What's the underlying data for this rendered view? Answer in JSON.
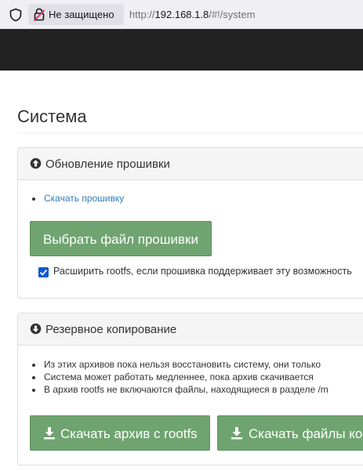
{
  "browser": {
    "security_label": "Не защищено",
    "url_scheme": "http://",
    "url_host": "192.168.1.8",
    "url_path": "/#!/system"
  },
  "page": {
    "title": "Система"
  },
  "firmware_panel": {
    "title": "Обновление прошивки",
    "links": [
      "Скачать прошивку"
    ],
    "choose_button": "Выбрать файл прошивки",
    "expand_rootfs_checked": true,
    "expand_rootfs_label": "Расширить rootfs, если прошивка поддерживает эту возможность"
  },
  "backup_panel": {
    "title": "Резервное копирование",
    "notes": [
      "Из этих архивов пока нельзя восстановить систему, они только",
      "Система может работать медленнее, пока архив скачивается",
      "В архив rootfs не включаются файлы, находящиеся в разделе /m"
    ],
    "download_rootfs_button": "Скачать архив с rootfs",
    "download_files_button": "Скачать файлы ко"
  },
  "colors": {
    "navbar": "#222222",
    "button_green": "#6fa470",
    "link": "#337ab7",
    "checkbox": "#0b57d0"
  }
}
